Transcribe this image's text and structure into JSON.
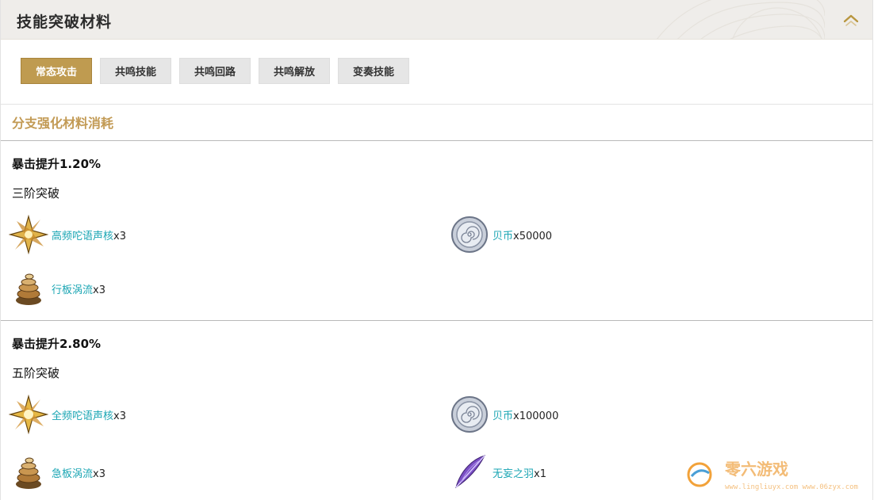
{
  "header": {
    "title": "技能突破材料"
  },
  "tabs": [
    {
      "label": "常态攻击",
      "active": true
    },
    {
      "label": "共鸣技能",
      "active": false
    },
    {
      "label": "共鸣回路",
      "active": false
    },
    {
      "label": "共鸣解放",
      "active": false
    },
    {
      "label": "变奏技能",
      "active": false
    }
  ],
  "section": {
    "title": "分支强化材料消耗"
  },
  "blocks": [
    {
      "title": "暴击提升1.20%",
      "stage": "三阶突破",
      "materials": [
        {
          "name": "高频咜语声核",
          "qty": "x3",
          "icon": "star-core-icon"
        },
        {
          "name": "贝币",
          "qty": "x50000",
          "icon": "shell-coin-icon"
        },
        {
          "name": "行板涡流",
          "qty": "x3",
          "icon": "vortex-icon"
        }
      ]
    },
    {
      "title": "暴击提升2.80%",
      "stage": "五阶突破",
      "materials": [
        {
          "name": "全频咜语声核",
          "qty": "x3",
          "icon": "star-core-icon"
        },
        {
          "name": "贝币",
          "qty": "x100000",
          "icon": "shell-coin-icon"
        },
        {
          "name": "急板涡流",
          "qty": "x3",
          "icon": "vortex-icon"
        },
        {
          "name": "无妄之羽",
          "qty": "x1",
          "icon": "feather-icon"
        }
      ]
    }
  ],
  "watermark": {
    "name": "零六游戏",
    "url": "www.lingliuyx.com",
    "url2": "www.06zyx.com"
  },
  "colors": {
    "accent": "#bf9b50",
    "section": "#c29a54",
    "link": "#19a5b3"
  }
}
